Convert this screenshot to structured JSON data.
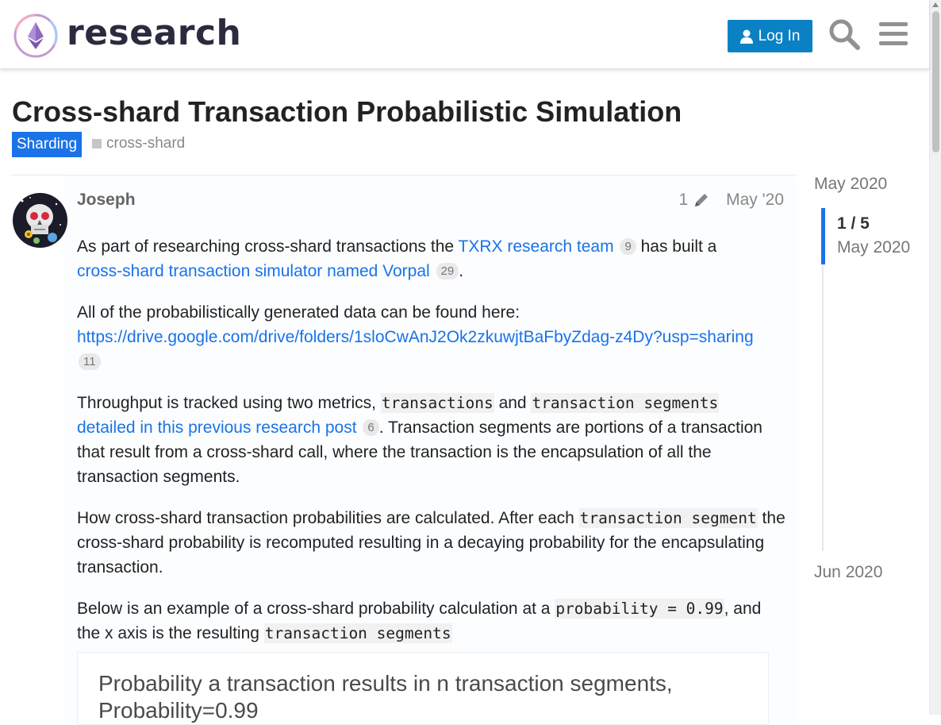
{
  "header": {
    "logo_text": "research",
    "login_label": "Log In",
    "search_icon": "search-icon",
    "menu_icon": "hamburger-menu-icon",
    "accent_color": "#0a81c4"
  },
  "topic": {
    "title": "Cross-shard Transaction Probabilistic Simulation",
    "category": "Sharding",
    "category_color": "#1a73e8",
    "tags": [
      "cross-shard"
    ]
  },
  "post": {
    "username": "Joseph",
    "edit_count": "1",
    "date": "May '20",
    "p1": {
      "before": "As part of researching cross-shard transactions the ",
      "link1": "TXRX research team",
      "link1_count": "9",
      "middle": " has built a",
      "link2": "cross-shard transaction simulator named Vorpal",
      "link2_count": "29",
      "after": "."
    },
    "p2": {
      "text": "All of the probabilistically generated data can be found here:",
      "link": "https://drive.google.com/drive/folders/1sloCwAnJ2Ok2zkuwjtBaFbyZdag-z4Dy?usp=sharing",
      "link_count": "11"
    },
    "p3": {
      "before": "Throughput is tracked using two metrics, ",
      "code1": "transactions",
      "and": " and ",
      "code2": "transaction segments",
      "link": "detailed in this previous research post",
      "link_count": "6",
      "after": ". Transaction segments are portions of a transaction that result from a cross-shard call, where the transaction is the encapsulation of all the transaction segments."
    },
    "p4": {
      "before": "How cross-shard transaction probabilities are calculated. After each ",
      "code": "transaction segment",
      "after": " the cross-shard probability is recomputed resulting in a decaying probability for the encapsulating transaction."
    },
    "p5": {
      "before": "Below is an example of a cross-shard probability calculation at a ",
      "code1": "probability = 0.99",
      "middle": ", and the x axis is the resulting ",
      "code2": "transaction segments"
    },
    "image_title": "Probability a transaction results in n transaction segments, Probability=0.99"
  },
  "timeline": {
    "start": "May 2020",
    "position": "1 / 5",
    "current_date": "May 2020",
    "end": "Jun 2020"
  }
}
